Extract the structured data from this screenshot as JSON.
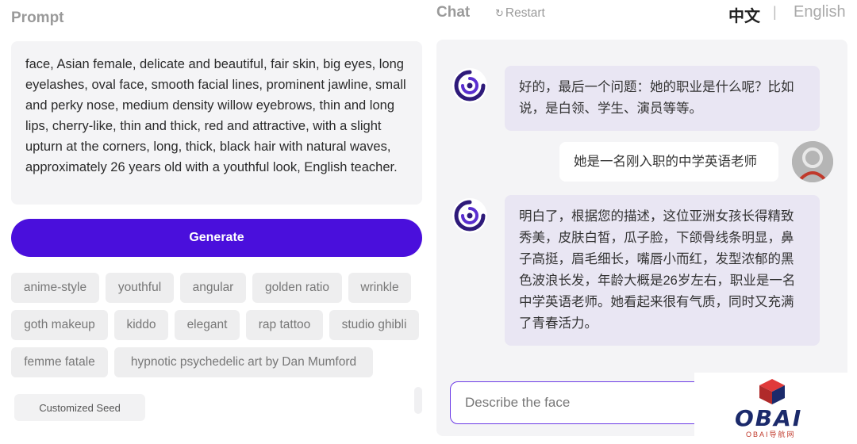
{
  "prompt": {
    "title": "Prompt",
    "text": "face, Asian female, delicate and beautiful, fair skin, big eyes, long eyelashes, oval face, smooth facial lines, prominent jawline, small and perky nose, medium density willow eyebrows, thin and long lips, cherry-like, thin and thick, red and attractive, with a slight upturn at the corners, long, thick, black hair with natural waves, approximately 26 years old with a youthful look, English teacher.",
    "generate_label": "Generate",
    "tags": [
      "anime-style",
      "youthful",
      "angular",
      "golden ratio",
      "wrinkle",
      "goth makeup",
      "kiddo",
      "elegant",
      "rap tattoo",
      "studio ghibli",
      "femme fatale",
      "hypnotic psychedelic art by Dan Mumford"
    ],
    "seed_label": "Customized Seed"
  },
  "chat": {
    "title": "Chat",
    "restart_label": "Restart",
    "lang_zh": "中文",
    "lang_sep": "|",
    "lang_en": "English",
    "messages": [
      {
        "role": "bot",
        "text": "好的，最后一个问题：她的职业是什么呢？比如说，是白领、学生、演员等等。"
      },
      {
        "role": "user",
        "text": "她是一名刚入职的中学英语老师"
      },
      {
        "role": "bot",
        "text": "明白了，根据您的描述，这位亚洲女孩长得精致秀美，皮肤白皙，瓜子脸，下颌骨线条明显，鼻子高挺，眉毛细长，嘴唇小而红，发型浓郁的黑色波浪长发，年龄大概是26岁左右，职业是一名中学英语老师。她看起来很有气质，同时又充满了青春活力。"
      }
    ],
    "input_placeholder": "Describe the face"
  },
  "logo": {
    "text": "OBAI",
    "sub": "OBAI导航网"
  },
  "colors": {
    "accent": "#4a0fdc",
    "bot_bubble": "#e9e6f3",
    "panel_bg": "#f4f4f6"
  }
}
